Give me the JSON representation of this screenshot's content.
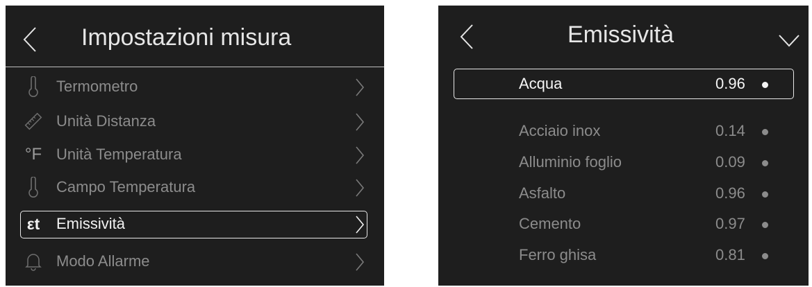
{
  "measure_settings": {
    "title": "Impostazioni misura",
    "items": [
      {
        "label": "Termometro",
        "icon": "thermometer-icon"
      },
      {
        "label": "Unità Distanza",
        "icon": "ruler-icon"
      },
      {
        "label": "Unità Temperatura",
        "icon": "fahrenheit-icon",
        "icon_text": "°F"
      },
      {
        "label": "Campo Temperatura",
        "icon": "thermometer-icon"
      },
      {
        "label": "Emissività",
        "icon": "emissivity-icon",
        "icon_text": "εt",
        "selected": true
      },
      {
        "label": "Modo Allarme",
        "icon": "bell-icon"
      }
    ]
  },
  "emissivity": {
    "title": "Emissività",
    "materials": [
      {
        "name": "Acqua",
        "value": "0.96",
        "selected": true
      },
      {
        "name": "Acciaio inox",
        "value": "0.14"
      },
      {
        "name": "Alluminio foglio",
        "value": "0.09"
      },
      {
        "name": "Asfalto",
        "value": "0.96"
      },
      {
        "name": "Cemento",
        "value": "0.97"
      },
      {
        "name": "Ferro ghisa",
        "value": "0.81"
      }
    ]
  },
  "colors": {
    "screen_background": "#1e1e1e",
    "active_text": "#f2f2f2",
    "inactive_text": "#8c8c8c",
    "selection_border": "#e8e8e8"
  }
}
